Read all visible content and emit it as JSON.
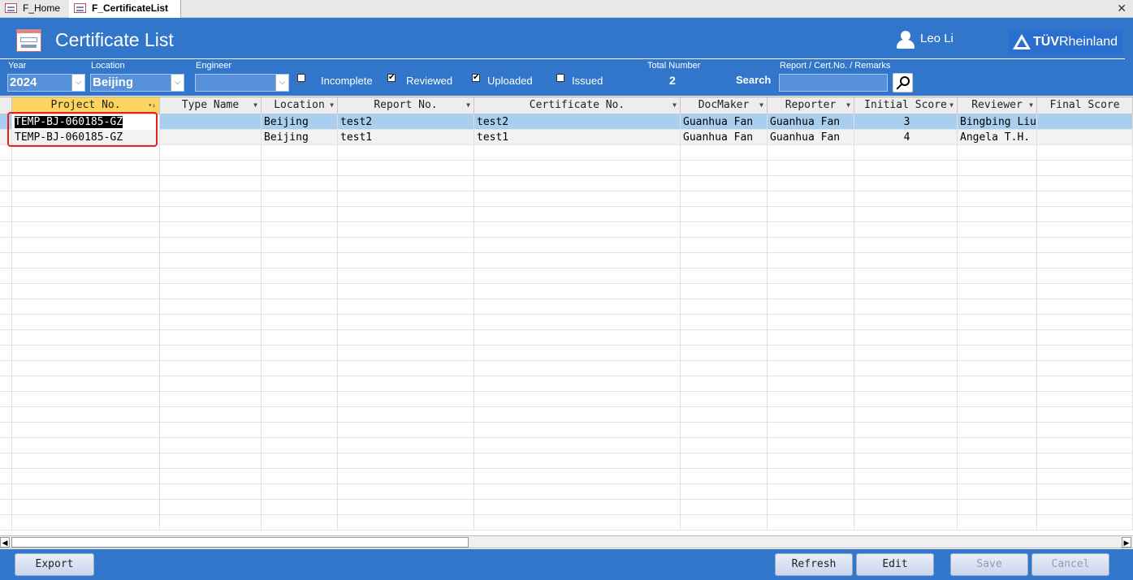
{
  "tabs": [
    {
      "label": "F_Home",
      "active": false
    },
    {
      "label": "F_CertificateList",
      "active": true
    }
  ],
  "header": {
    "title": "Certificate List",
    "user": "Leo Li",
    "logo": "TÜVRheinland",
    "logo_bold": "TÜV",
    "logo_rest": "Rheinland"
  },
  "filters": {
    "year": {
      "label": "Year",
      "value": "2024"
    },
    "location": {
      "label": "Location",
      "value": "Beijing"
    },
    "engineer": {
      "label": "Engineer",
      "value": ""
    },
    "checkboxes": [
      {
        "label": "Incomplete",
        "checked": false
      },
      {
        "label": "Reviewed",
        "checked": true
      },
      {
        "label": "Uploaded",
        "checked": true
      },
      {
        "label": "Issued",
        "checked": false
      }
    ],
    "total_label": "Total Number",
    "total_value": "2",
    "search_label": "Search",
    "search_hint": "Report / Cert.No. / Remarks",
    "search_value": ""
  },
  "grid": {
    "columns": [
      "Project No.",
      "Type Name",
      "Location",
      "Report No.",
      "Certificate No.",
      "DocMaker",
      "Reporter",
      "Initial Score",
      "Reviewer",
      "Final Score"
    ],
    "rows": [
      [
        "TEMP-BJ-060185-GZ",
        "",
        "Beijing",
        "test2",
        "test2",
        "Guanhua Fan",
        "Guanhua Fan",
        "3",
        "Bingbing Liu",
        ""
      ],
      [
        "TEMP-BJ-060185-GZ",
        "",
        "Beijing",
        "test1",
        "test1",
        "Guanhua Fan",
        "Guanhua Fan",
        "4",
        "Angela T.H.",
        ""
      ]
    ],
    "selected_row": 0,
    "sorted_column": "Project No."
  },
  "footer": {
    "export": "Export",
    "refresh": "Refresh",
    "edit": "Edit",
    "save": "Save",
    "cancel": "Cancel"
  },
  "colors": {
    "band": "#3276cc",
    "selected_row": "#a9cff0",
    "header_selected": "#fbd560",
    "highlight_box": "#e62020"
  }
}
